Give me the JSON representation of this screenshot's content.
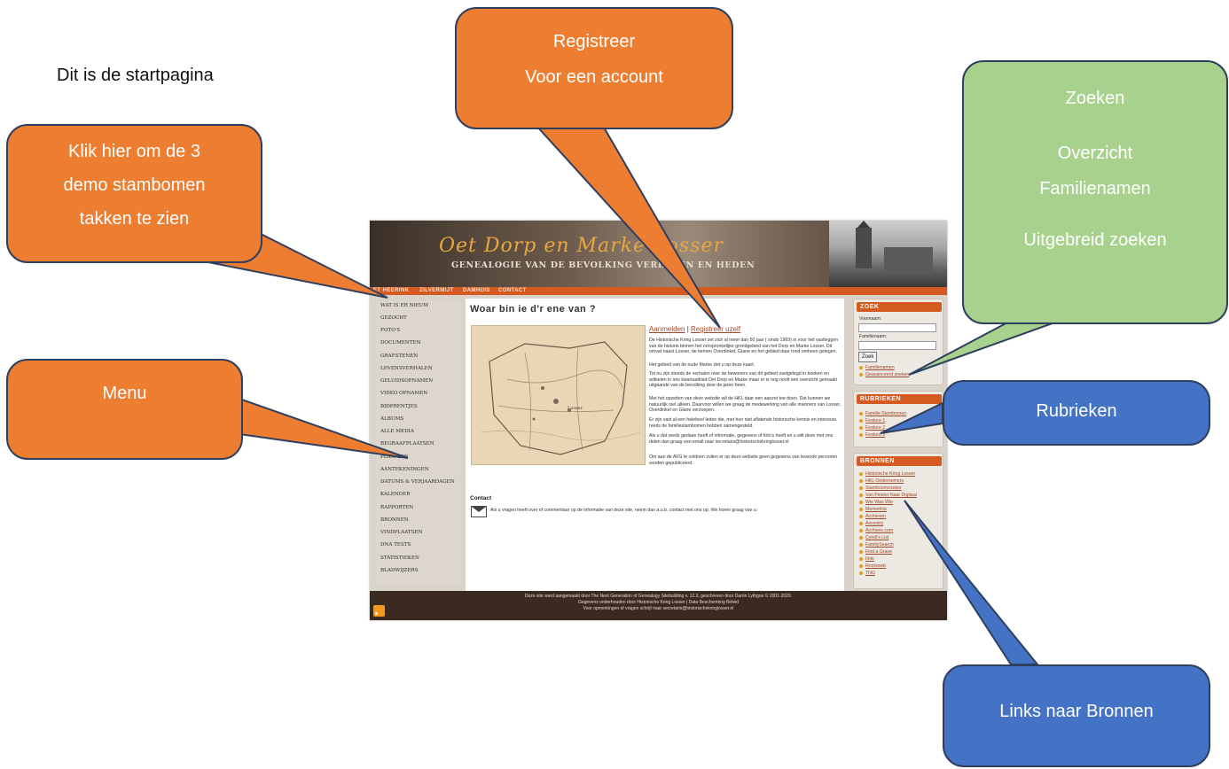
{
  "intro_text": "Dit is de startpagina",
  "site": {
    "title": "Oet Dorp en Marke Losser",
    "subtitle": "GENEALOGIE VAN DE BEVOLKING VERLEDEN EN HEDEN",
    "nav": [
      "ET HEERINK",
      "ZILVERMIJT",
      "DAMHUIS",
      "CONTACT"
    ],
    "menu": [
      "WAT IS ER NIEUW",
      "GEZOCHT",
      "FOTO'S",
      "DOCUMENTEN",
      "GRAFSTENEN",
      "LEVENSVERHALEN",
      "GELUIDSOPNAMEN",
      "VIDEO OPNAMEN",
      "BIDPRENTJES",
      "ALBUMS",
      "ALLE MEDIA",
      "BEGRAAFPLAATSEN",
      "PLAATSEN",
      "AANTEKENINGEN",
      "DATUMS & VERJAARDAGEN",
      "KALENDER",
      "RAPPORTEN",
      "BRONNEN",
      "VINDPLAATSEN",
      "DNA TESTS",
      "STATISTIEKEN",
      "BLADWIJZERS"
    ],
    "heading": "Woar bin ie d'r ene van ?",
    "login_link": "Aanmelden",
    "login_sep": "|",
    "register_link": "Registreer uzelf",
    "paragraphs": [
      "De Historische Kring Losser zet zich al meer dan 50 jaar ( sinds 1969) in voor het vastleggen van de historie binnen het oorspronkelijke grondgebied van het Dorp en Marke Losser. Dit omvat naast Losser, de kernen Overdinkel, Glane en het gebied daar rond omheen gelegen.",
      "Het gebied van de oude Marke ziet u op deze kaart.",
      "Tot nu zijn steeds de verhalen over de bewoners van dit gebied vastgelegd in boeken en artikelen in ons kwartaalblad Oet Dorp en Marke maar er is nog nooit een overzicht gemaakt uitgaande van de bevolking door de jaren heen.",
      "Met het opzetten van deze website wil de HKL daar een aanzet toe doen. Dat kunnen we natuurlijk niet alleen. Daarvoor willen we graag de medewerking van alle inwoners van Losser, Overdinkel en Glane verzoepen.",
      "Er zijn vast al een helebeel leden die, met hun niet aflatende historische kennis en interesse, reeds de familiestambomen hebben samengesteld.",
      "Als u dat reeds gedaan heeft of informatie, gegevens of foto's heeft en u wilt deze met ons delen dan graag een email naar secretaris@historischekringlosser.nl",
      "Om aan de AVG te voldoen zullen er op deze website geen gegevens van levende personen worden gepubliceerd."
    ],
    "map_label": "Losser",
    "contact_heading": "Contact",
    "contact_text": "Als u vragen heeft over of commentaar op de informatie van deze site, neem dan a.u.b. contact met ons op. We horen graag van u.",
    "zoek": {
      "title": "ZOEK",
      "voornaam_label": "Voornaam:",
      "familienaam_label": "Familienaam:",
      "button": "Zoek",
      "links": [
        "Familienamen",
        "Geavanceerd zoeken"
      ]
    },
    "rubrieken": {
      "title": "RUBRIEKEN",
      "links": [
        "Familie Stambomen",
        "Feature 1",
        "Feature 2",
        "Feature 3"
      ]
    },
    "bronnen": {
      "title": "BRONNEN",
      "links": [
        "Historische Kring Losser",
        "HKL Ondernemers",
        "Stamboomzoeker",
        "Van Pinster Naar Digitaal",
        "Wie Was Wie",
        "Memorlink",
        "Archieven",
        "Ancestry",
        "Archives.com",
        "Cyndi's List",
        "FamilySearch",
        "Find a Grave",
        "Ilnfo",
        "Rootsweb",
        "TNG"
      ]
    },
    "footer": [
      "Deze site werd aangemaakt door The Next Generation of Genealogy Sitebuilding v. 12.3, geschreven door Darrin Lythgoe © 2001-2020.",
      "Gegevens onderhouden door Historische Kring Losser | Data Bescherming Beleid",
      "Voor opmerkingen of vragen schrijf naar secretaris@historischekringlosser.nl"
    ]
  },
  "callouts": {
    "registreer": [
      "Registreer",
      "Voor een account"
    ],
    "klik": [
      "Klik hier om de 3",
      "demo  stambomen",
      "takken te zien"
    ],
    "zoeken": [
      "Zoeken",
      "Overzicht",
      "Familienamen",
      "Uitgebreid zoeken"
    ],
    "menu": [
      "Menu"
    ],
    "rubrieken": [
      "Rubrieken"
    ],
    "bronnen": [
      "Links naar Bronnen"
    ]
  },
  "colors": {
    "orange_callout": "#ed7d31",
    "green_callout": "#a9d18e",
    "blue_callout": "#4472c4",
    "site_accent": "#d45a22"
  }
}
